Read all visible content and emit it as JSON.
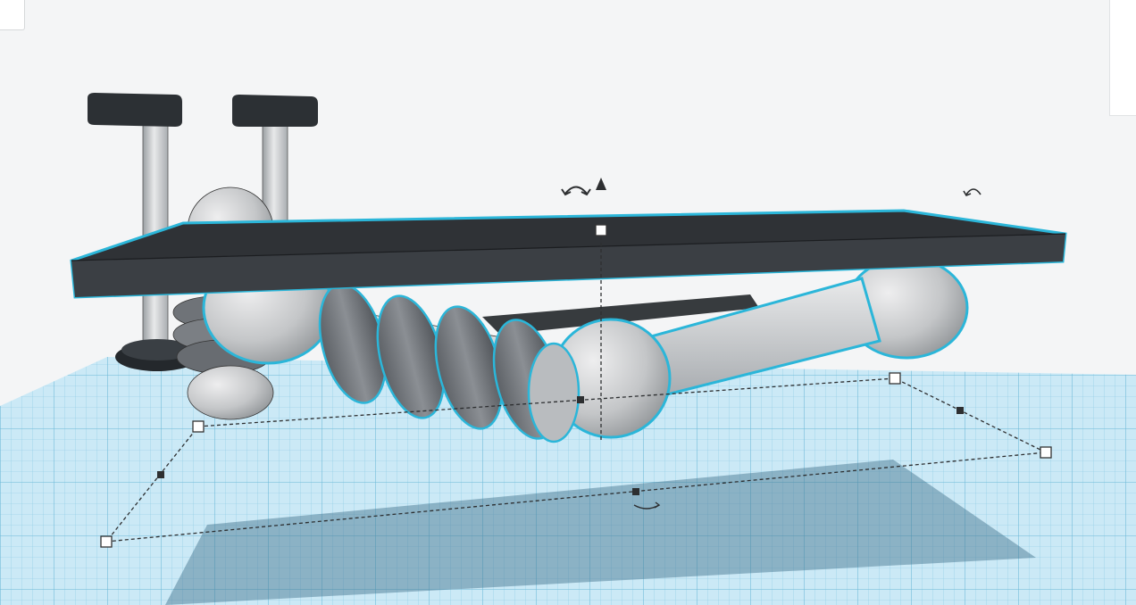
{
  "app": {
    "view": "3d-workplane",
    "selection_color": "#2bb6d9",
    "workplane_color": "#a8dcef"
  },
  "icons": {
    "rotate_left": "rotate-arrow-icon",
    "rotate_right": "rotate-arrow-icon",
    "lift_up": "triangle-up-icon",
    "rotate_base": "rotate-horizontal-icon"
  }
}
